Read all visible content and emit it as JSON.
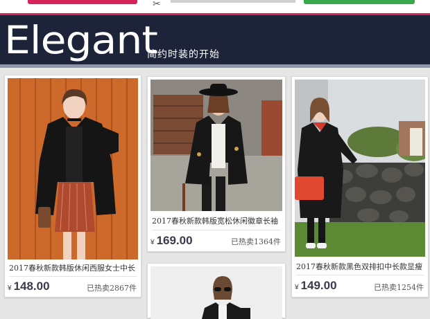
{
  "banner": {
    "title": "Elegant",
    "subtitle": "简约时装的开始"
  },
  "colors": {
    "banner_bg": "#1d2339",
    "accent_pink": "#d6245a",
    "accent_green": "#38a84a",
    "price_text": "#3a3a4a"
  },
  "products": [
    {
      "name": "2017春秋新款韩版休闲西服女士中长",
      "currency": "¥",
      "price": "148.00",
      "sold": "已热卖2867件"
    },
    {
      "name": "2017春秋新款韩版宽松休闲徽章长袖",
      "currency": "¥",
      "price": "169.00",
      "sold": "已热卖1364件"
    },
    {
      "name": "2017春秋新款黑色双排扣中长款显瘦",
      "currency": "¥",
      "price": "149.00",
      "sold": "已热卖1254件"
    }
  ]
}
